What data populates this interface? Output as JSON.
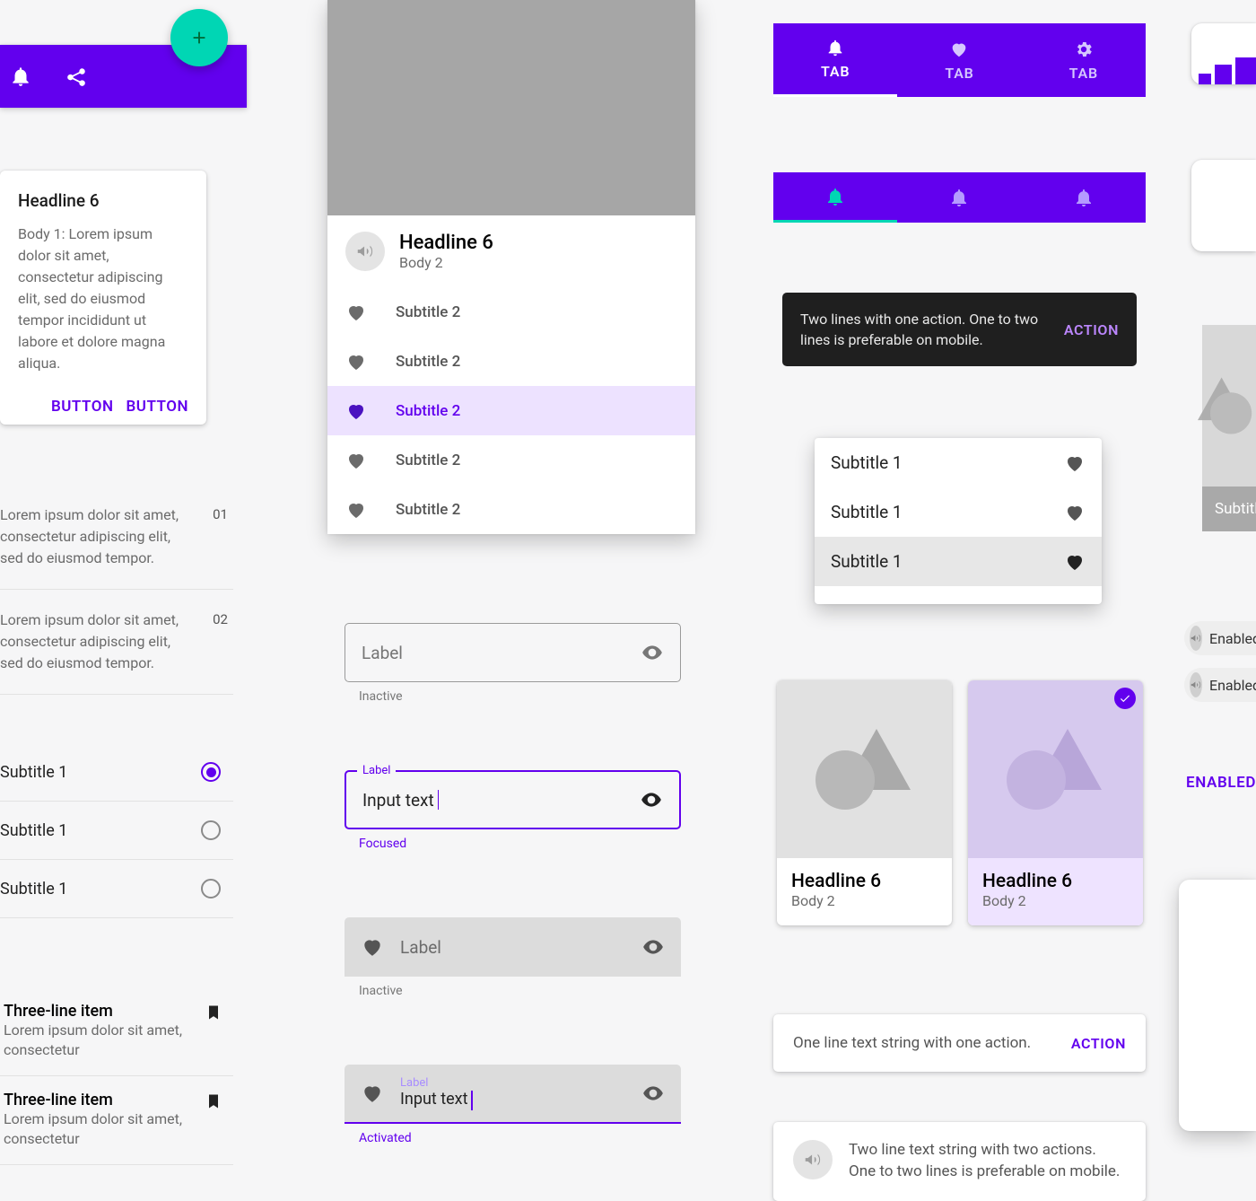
{
  "appbar": {
    "icons": [
      "bell",
      "share"
    ]
  },
  "card1": {
    "headline": "Headline 6",
    "body_prefix": "Body 1:",
    "body": "Body 1: Lorem ipsum dolor sit amet, consectetur adipiscing elit, sed do eiusmod tempor incididunt ut labore et dolore magna aliqua.",
    "button1": "BUTTON",
    "button2": "BUTTON"
  },
  "numlist": [
    {
      "text": "Lorem ipsum dolor sit amet, consectetur adipiscing elit, sed do eiusmod tempor.",
      "num": "01"
    },
    {
      "text": "Lorem ipsum dolor sit amet, consectetur adipiscing elit, sed do eiusmod tempor.",
      "num": "02"
    }
  ],
  "radios": [
    {
      "label": "Subtitle 1",
      "selected": true
    },
    {
      "label": "Subtitle 1",
      "selected": false
    },
    {
      "label": "Subtitle 1",
      "selected": false
    }
  ],
  "tlines": [
    {
      "title": "Three-line item",
      "body": "Lorem ipsum dolor sit amet, consectetur"
    },
    {
      "title": "Three-line item",
      "body": "Lorem ipsum dolor sit amet, consectetur"
    }
  ],
  "bigcard": {
    "headline": "Headline 6",
    "body": "Body 2",
    "items": [
      {
        "label": "Subtitle 2",
        "selected": false
      },
      {
        "label": "Subtitle 2",
        "selected": false
      },
      {
        "label": "Subtitle 2",
        "selected": true
      },
      {
        "label": "Subtitle 2",
        "selected": false
      },
      {
        "label": "Subtitle 2",
        "selected": false
      }
    ]
  },
  "tf_outline_inactive": {
    "label": "Label",
    "helper": "Inactive"
  },
  "tf_outline_focused": {
    "float": "Label",
    "value": "Input text",
    "helper": "Focused"
  },
  "tf_filled_inactive": {
    "label": "Label",
    "helper": "Inactive"
  },
  "tf_filled_activated": {
    "float": "Label",
    "value": "Input text",
    "helper": "Activated"
  },
  "tabs": [
    {
      "label": "TAB",
      "icon": "bell",
      "active": true
    },
    {
      "label": "TAB",
      "icon": "heart",
      "active": false
    },
    {
      "label": "TAB",
      "icon": "gear",
      "active": false
    }
  ],
  "tabs2": [
    {
      "active": true
    },
    {
      "active": false
    },
    {
      "active": false
    }
  ],
  "snackbar": {
    "text": "Two lines with one action. One to two lines is preferable on mobile.",
    "action": "ACTION"
  },
  "menu3": [
    {
      "label": "Subtitle 1",
      "selected": false
    },
    {
      "label": "Subtitle 1",
      "selected": false
    },
    {
      "label": "Subtitle 1",
      "selected": true
    }
  ],
  "gcards": [
    {
      "headline": "Headline 6",
      "body": "Body 2",
      "selected": false
    },
    {
      "headline": "Headline 6",
      "body": "Body 2",
      "selected": true
    }
  ],
  "snack2": {
    "text": "One line text string with one action.",
    "action": "ACTION"
  },
  "snack3": {
    "text": "Two line text string with two actions. One to two lines is preferable on mobile."
  },
  "grey2": {
    "caption": "Subtitle"
  },
  "chips": [
    {
      "label": "Enabled"
    },
    {
      "label": "Enabled"
    }
  ],
  "enable": "ENABLED"
}
